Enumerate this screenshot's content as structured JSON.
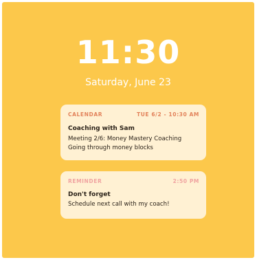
{
  "lockscreen": {
    "time": "11:30",
    "date": "Saturday, June 23",
    "background_color": "#FCC84B"
  },
  "notifications": [
    {
      "app": "CALENDAR",
      "time": "TUE 6/2 - 10:30 AM",
      "title": "Coaching with Sam",
      "body_lines": [
        "Meeting 2/6: Money Mastery Coaching",
        "Going through money blocks"
      ],
      "accent_color": "#E2825A"
    },
    {
      "app": "REMINDER",
      "time": "2:50 PM",
      "title": "Don't forget",
      "body_lines": [
        "Schedule next call with my coach!"
      ],
      "accent_color": "#F0A2A0"
    }
  ]
}
